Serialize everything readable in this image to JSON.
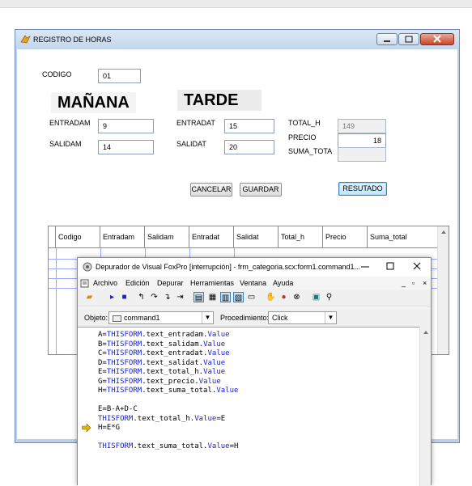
{
  "form": {
    "title": "REGISTRO DE HORAS",
    "labels": {
      "codigo": "CODIGO",
      "entradam": "ENTRADAM",
      "salidam": "SALIDAM",
      "entradat": "ENTRADAT",
      "salidat": "SALIDAT",
      "total_h": "TOTAL_H",
      "precio": "PRECIO",
      "suma_tota": "SUMA_TOTA"
    },
    "headings": {
      "manana": "MAÑANA",
      "tarde": "TARDE"
    },
    "values": {
      "codigo": "01",
      "entradam": "9",
      "salidam": "14",
      "entradat": "15",
      "salidat": "20",
      "total_h": "149",
      "precio": "18",
      "suma_total": ""
    },
    "buttons": {
      "cancelar": "CANCELAR",
      "guardar": "GUARDAR",
      "resultado": "RESUTADO"
    },
    "grid": {
      "columns": [
        "Codigo",
        "Entradam",
        "Salidam",
        "Entradat",
        "Salidat",
        "Total_h",
        "Precio",
        "Suma_total"
      ]
    }
  },
  "debugger": {
    "title": "Depurador de Visual FoxPro [interrupción] - frm_categoria.scx:form1.command1...",
    "menu": [
      "Archivo",
      "Edición",
      "Depurar",
      "Herramientas",
      "Ventana",
      "Ayuda"
    ],
    "objeto_label": "Objeto:",
    "objeto_value": "command1",
    "procedimiento_label": "Procedimiento:",
    "procedimiento_value": "Click",
    "code": [
      {
        "a": "A=",
        "b": "THISFORM",
        "c": ".text_entradam.",
        "d": "Value",
        "e": ""
      },
      {
        "a": "B=",
        "b": "THISFORM",
        "c": ".text_salidam.",
        "d": "Value",
        "e": ""
      },
      {
        "a": "C=",
        "b": "THISFORM",
        "c": ".text_entradat.",
        "d": "Value",
        "e": ""
      },
      {
        "a": "D=",
        "b": "THISFORM",
        "c": ".text_salidat.",
        "d": "Value",
        "e": ""
      },
      {
        "a": "E=",
        "b": "THISFORM",
        "c": ".text_total_h.",
        "d": "Value",
        "e": ""
      },
      {
        "a": "G=",
        "b": "THISFORM",
        "c": ".text_precio.",
        "d": "Value",
        "e": ""
      },
      {
        "a": "H=",
        "b": "THISFORM",
        "c": ".text_suma_total.",
        "d": "Value",
        "e": ""
      },
      {
        "a": "",
        "b": "",
        "c": "",
        "d": "",
        "e": ""
      },
      {
        "a": "E=B-A+D-C",
        "b": "",
        "c": "",
        "d": "",
        "e": ""
      },
      {
        "a": "",
        "b": "THISFORM",
        "c": ".text_total_h.",
        "d": "Value",
        "e": "=E"
      },
      {
        "a": "H=E*G",
        "b": "",
        "c": "",
        "d": "",
        "e": ""
      },
      {
        "a": "",
        "b": "",
        "c": "",
        "d": "",
        "e": ""
      },
      {
        "a": "",
        "b": "THISFORM",
        "c": ".text_suma_total.",
        "d": "Value",
        "e": "=H"
      }
    ]
  },
  "colors": {
    "keyword": "#1c23cf",
    "arrow": "#e0b400"
  }
}
